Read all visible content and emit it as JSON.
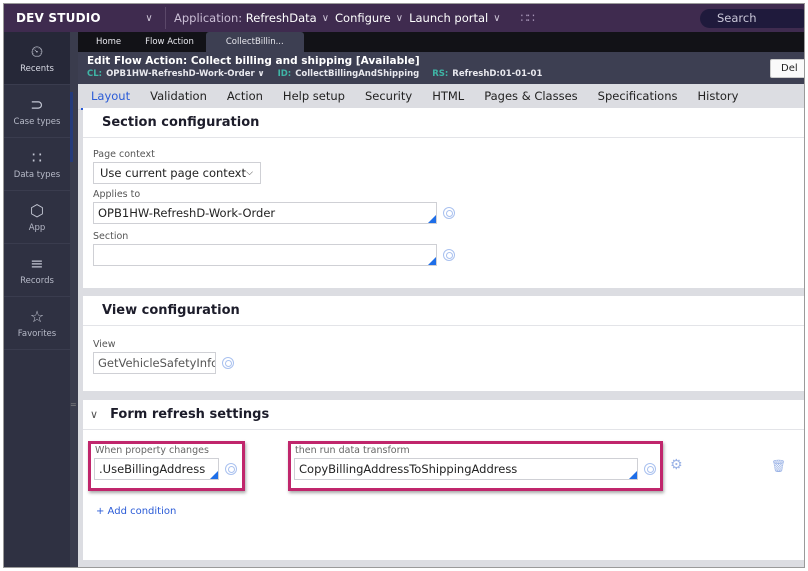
{
  "topbar": {
    "brand": "DEV STUDIO",
    "application_label": "Application:",
    "application_value": "RefreshData",
    "configure": "Configure",
    "launch_portal": "Launch portal",
    "search_placeholder": "Search"
  },
  "sidebar": {
    "items": [
      {
        "label": "Recents",
        "icon": "⏲"
      },
      {
        "label": "Case types",
        "icon": "⊃"
      },
      {
        "label": "Data types",
        "icon": "∷"
      },
      {
        "label": "App",
        "icon": "⬡"
      },
      {
        "label": "Records",
        "icon": "≡"
      },
      {
        "label": "Favorites",
        "icon": "☆"
      }
    ]
  },
  "doc_tabs": [
    "Home",
    "Flow Action",
    "CollectBillin..."
  ],
  "header": {
    "title": "Edit  Flow Action: Collect billing and shipping [Available]",
    "cl_key": "CL:",
    "cl_value": "OPB1HW-RefreshD-Work-Order ∨",
    "id_key": "ID:",
    "id_value": "CollectBillingAndShipping",
    "rs_key": "RS:",
    "rs_value": "RefreshD:01-01-01",
    "delete_label": "Del"
  },
  "rule_tabs": [
    "Layout",
    "Validation",
    "Action",
    "Help setup",
    "Security",
    "HTML",
    "Pages & Classes",
    "Specifications",
    "History"
  ],
  "section_config": {
    "title": "Section configuration",
    "page_context_label": "Page context",
    "page_context_value": "Use current page context",
    "applies_to_label": "Applies to",
    "applies_to_value": "OPB1HW-RefreshD-Work-Order",
    "section_label": "Section",
    "section_value": ""
  },
  "view_config": {
    "title": "View configuration",
    "view_label": "View",
    "view_value": "GetVehicleSafetyInform"
  },
  "form_refresh": {
    "title": "Form refresh settings",
    "when_label": "When property changes",
    "when_value": ".UseBillingAddress",
    "then_label": "then run data transform",
    "then_value": "CopyBillingAddressToShippingAddress",
    "add_condition": "+ Add condition"
  },
  "colors": {
    "accent": "#2a5bd7",
    "highlight": "#c0266c",
    "topbar": "#3f2b4f",
    "sidebar": "#2f3142"
  }
}
